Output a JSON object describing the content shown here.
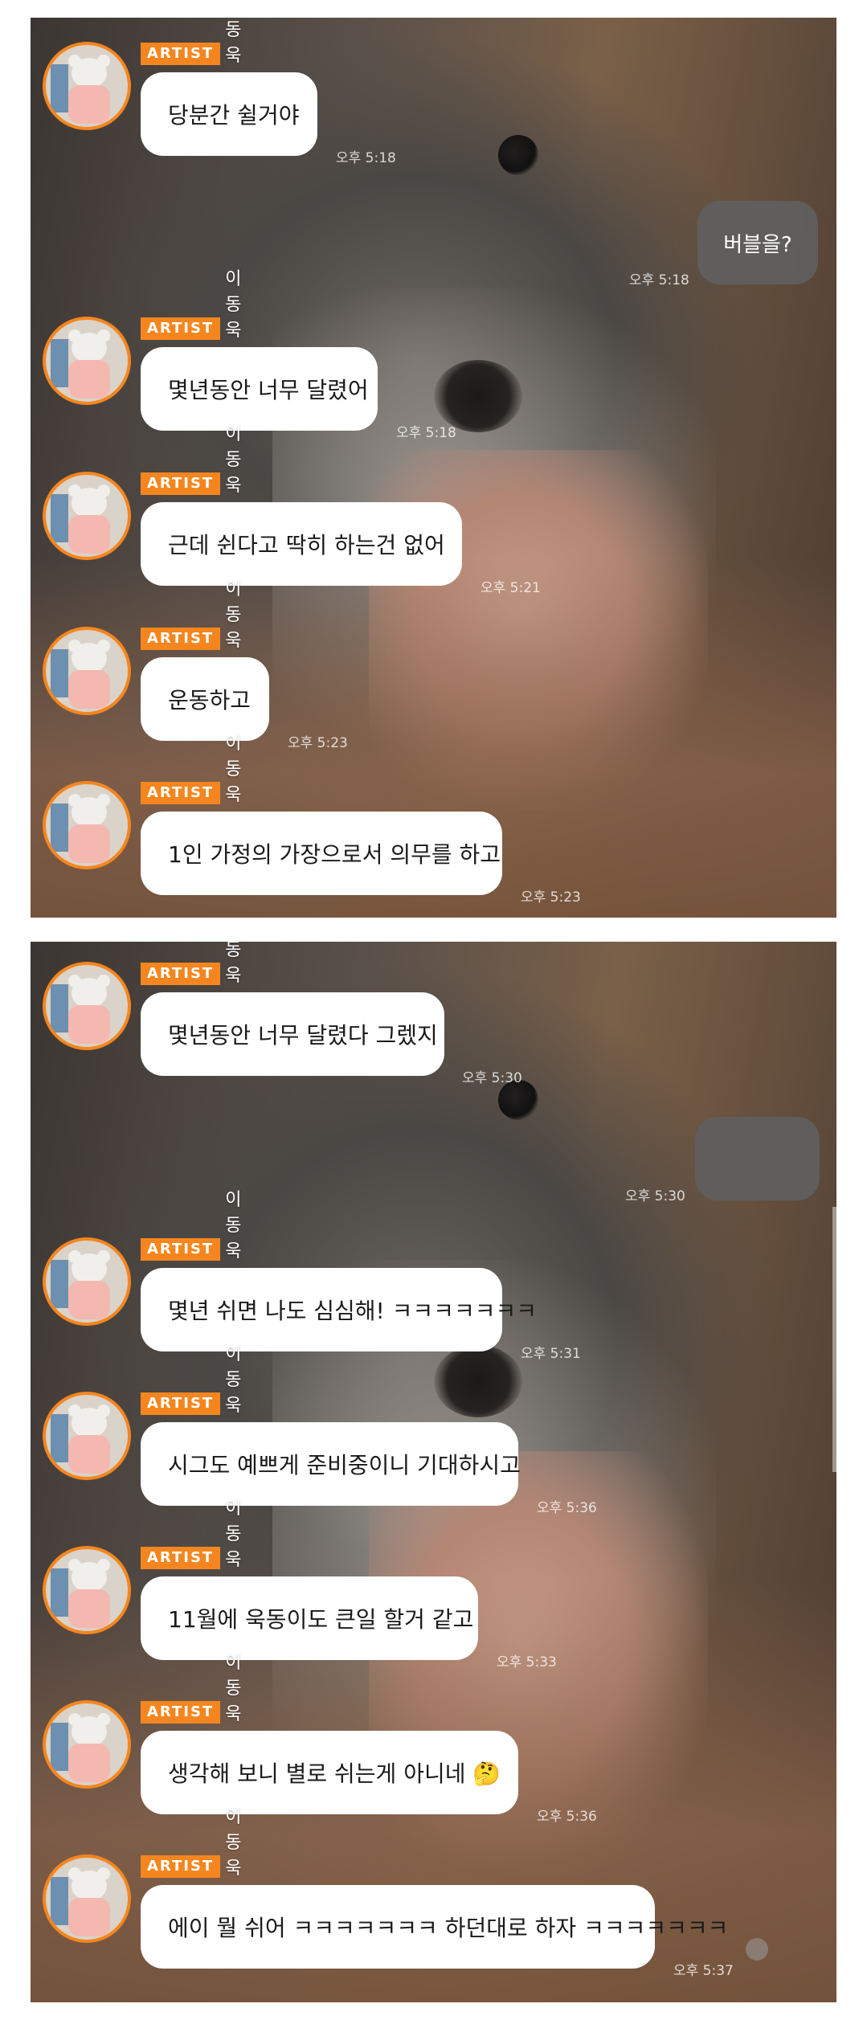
{
  "badge_label": "ARTIST",
  "nickname": "이동욱동이",
  "panel1": {
    "messages": [
      {
        "text": "당분간 쉴거야",
        "time": "오후 5:18"
      },
      {
        "text": "몇년동안 너무 달렸어",
        "time": "오후 5:18"
      },
      {
        "text": "근데 쉰다고 딱히 하는건 없어",
        "time": "오후 5:21"
      },
      {
        "text": "운동하고",
        "time": "오후 5:23"
      },
      {
        "text": "1인 가정의 가장으로서 의무를 하고",
        "time": "오후 5:23"
      }
    ],
    "user_reply": {
      "text": "버블을?",
      "time": "오후 5:18"
    }
  },
  "panel2": {
    "messages": [
      {
        "text": "몇년동안 너무 달렸다 그렜지",
        "time": "오후 5:30"
      },
      {
        "text": "몇년 쉬면 나도 심심해! ㅋㅋㅋㅋㅋㅋㅋ",
        "time": "오후 5:31"
      },
      {
        "text": "시그도 예쁘게 준비중이니 기대하시고",
        "time": "오후 5:36"
      },
      {
        "text": "11월에 욱동이도 큰일 할거 같고",
        "time": "오후 5:33"
      },
      {
        "text": "생각해 보니 별로 쉬는게 아니네 🤔",
        "time": "오후 5:36"
      },
      {
        "text": "에이 뭘 쉬어 ㅋㅋㅋㅋㅋㅋㅋ 하던대로 하자 ㅋㅋㅋㅋㅋㅋㅋ",
        "time": "오후 5:37"
      }
    ],
    "user_reply": {
      "text": "",
      "time": "오후 5:30"
    }
  },
  "colors": {
    "accent": "#f5861f",
    "bubble": "#ffffff",
    "user_bubble": "#5f5f5f"
  },
  "icons": [
    "artist-avatar-icon",
    "scroll-indicator-icon"
  ]
}
